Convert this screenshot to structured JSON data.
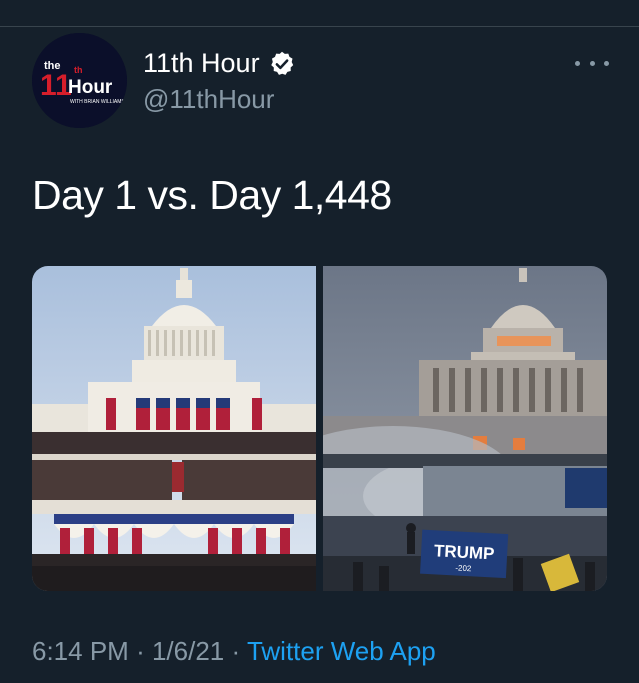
{
  "account": {
    "name": "11th Hour",
    "handle": "@11thHour",
    "verified": true,
    "avatar_logo": {
      "top": "the",
      "number": "11",
      "suffix": "th",
      "word": "Hour",
      "byline": "WITH BRIAN WILLIAMS"
    }
  },
  "tweet": {
    "text": "Day 1 vs. Day 1,448",
    "time": "6:14 PM",
    "separator": "·",
    "date": "1/6/21",
    "source": "Twitter Web App"
  },
  "media": {
    "left_image": "capitol-inauguration-photo",
    "right_image": "capitol-riot-photo",
    "right_sign_text": "TRUMP",
    "right_sign_sub": "-202"
  },
  "icons": {
    "verified": "verified-badge-icon",
    "more": "more-options-icon"
  },
  "colors": {
    "background": "#15202b",
    "primary_text": "#ffffff",
    "secondary_text": "#8899a6",
    "link": "#1da1f2",
    "divider": "#38444d"
  }
}
